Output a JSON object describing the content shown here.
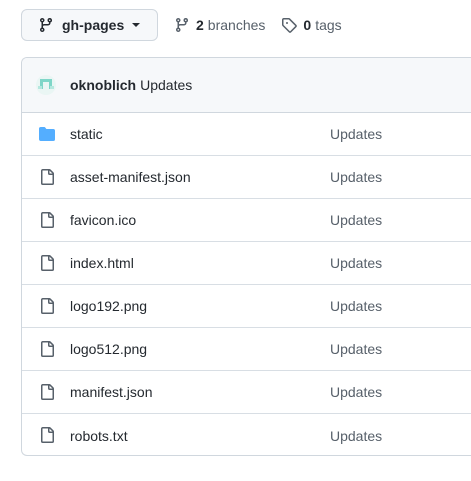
{
  "branch_selector": {
    "label": "gh-pages",
    "icon": "git-branch-icon"
  },
  "branches": {
    "count": "2",
    "label": "branches",
    "icon": "git-branch-icon"
  },
  "tags": {
    "count": "0",
    "label": "tags",
    "icon": "tag-icon"
  },
  "latest_commit": {
    "author": "oknoblich",
    "message": "Updates"
  },
  "files": [
    {
      "name": "static",
      "type": "folder",
      "commit": "Updates"
    },
    {
      "name": "asset-manifest.json",
      "type": "file",
      "commit": "Updates"
    },
    {
      "name": "favicon.ico",
      "type": "file",
      "commit": "Updates"
    },
    {
      "name": "index.html",
      "type": "file",
      "commit": "Updates"
    },
    {
      "name": "logo192.png",
      "type": "file",
      "commit": "Updates"
    },
    {
      "name": "logo512.png",
      "type": "file",
      "commit": "Updates"
    },
    {
      "name": "manifest.json",
      "type": "file",
      "commit": "Updates"
    },
    {
      "name": "robots.txt",
      "type": "file",
      "commit": "Updates"
    }
  ],
  "colors": {
    "folder": "#54aeff",
    "file_icon": "#57606a",
    "border": "#d0d7de"
  }
}
